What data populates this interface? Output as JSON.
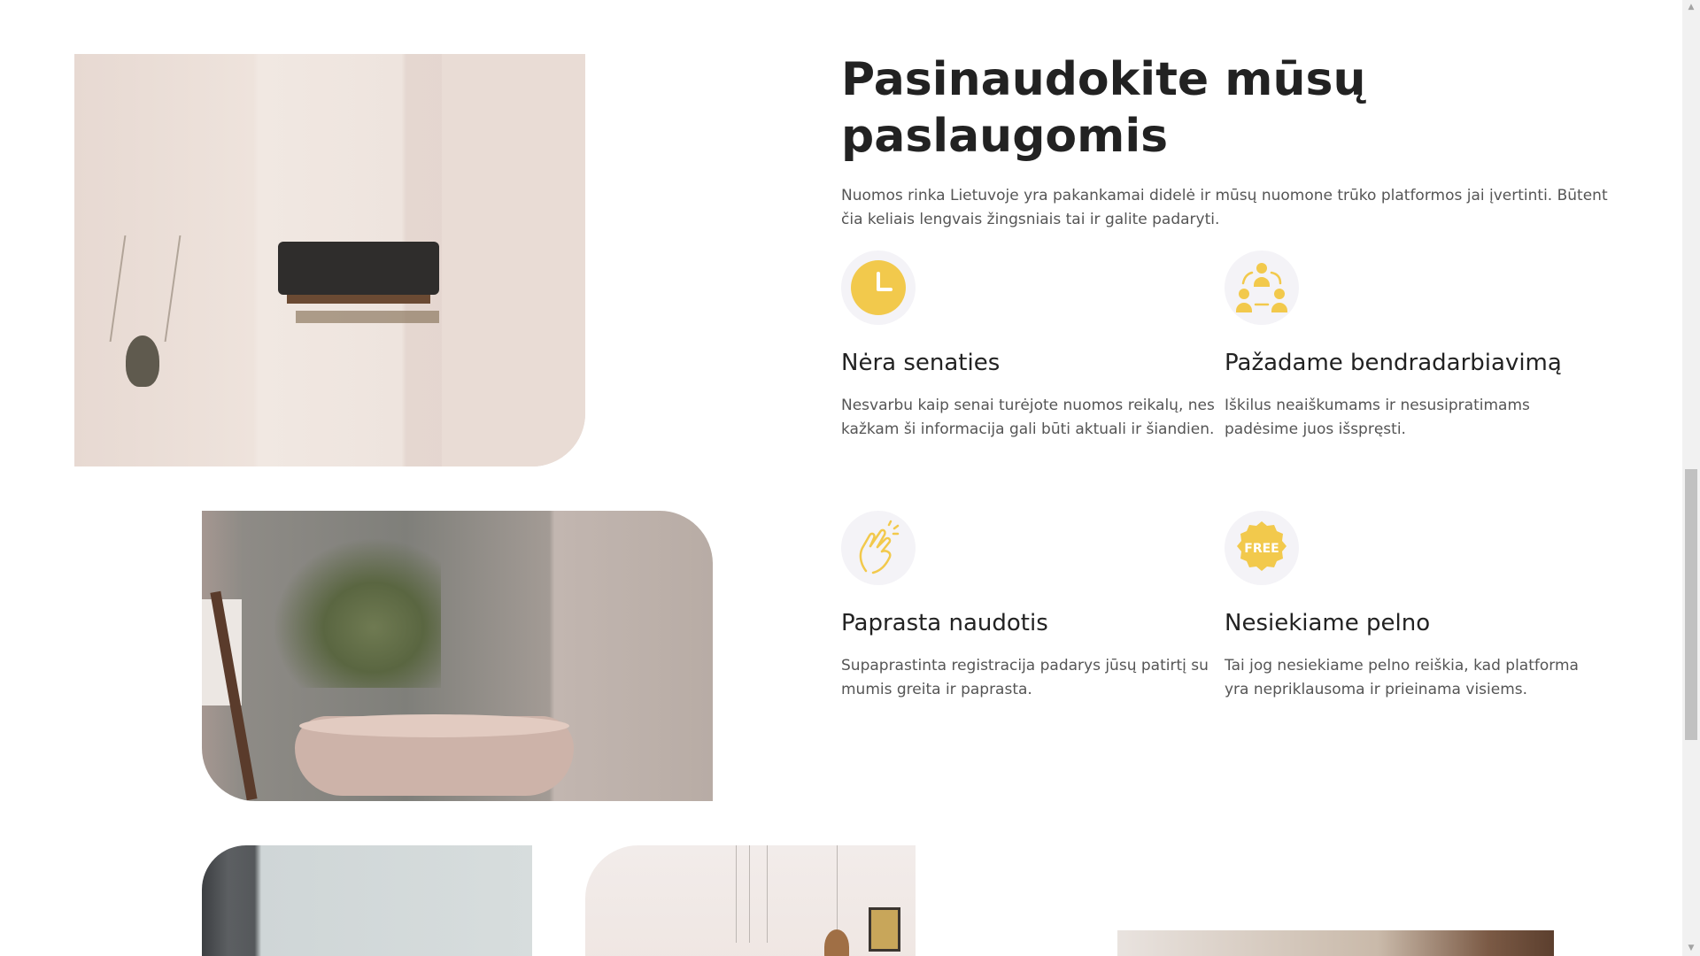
{
  "section": {
    "heading": "Pasinaudokite mūsų paslaugomis",
    "intro": "Nuomos rinka Lietuvoje yra pakankamai didelė ir mūsų nuomone trūko platformos jai įvertinti. Būtent čia keliais lengvais žingsniais tai ir galite padaryti."
  },
  "features": [
    {
      "icon": "clock-icon",
      "title": "Nėra senaties",
      "text": "Nesvarbu kaip senai turėjote nuomos reikalų, nes kažkam ši informacija gali būti aktuali ir šiandien."
    },
    {
      "icon": "collaboration-icon",
      "title": "Pažadame bendradarbiavimą",
      "text": "Iškilus neaiškumams ir nesusipratimams padėsime juos išspręsti."
    },
    {
      "icon": "snap-hand-icon",
      "title": "Paprasta naudotis",
      "text": "Supaprastinta registracija padarys jūsų patirtį su mumis greita ir paprasta."
    },
    {
      "icon": "free-badge-icon",
      "badge_text": "FREE",
      "title": "Nesiekiame pelno",
      "text": "Tai jog nesiekiame pelno reiškia, kad platforma yra nepriklausoma ir prieinama visiems."
    }
  ],
  "images": {
    "living_room": "living-room-photo",
    "bathroom": "bathroom-photo",
    "window": "window-photo",
    "interior": "interior-photo",
    "kitchen": "kitchen-photo"
  },
  "colors": {
    "accent": "#f2c94c",
    "icon_bg": "#f4f3f7",
    "heading": "#222222",
    "body_text": "#555555"
  },
  "scrollbar": {
    "up_arrow": "▲",
    "down_arrow": "▼"
  }
}
